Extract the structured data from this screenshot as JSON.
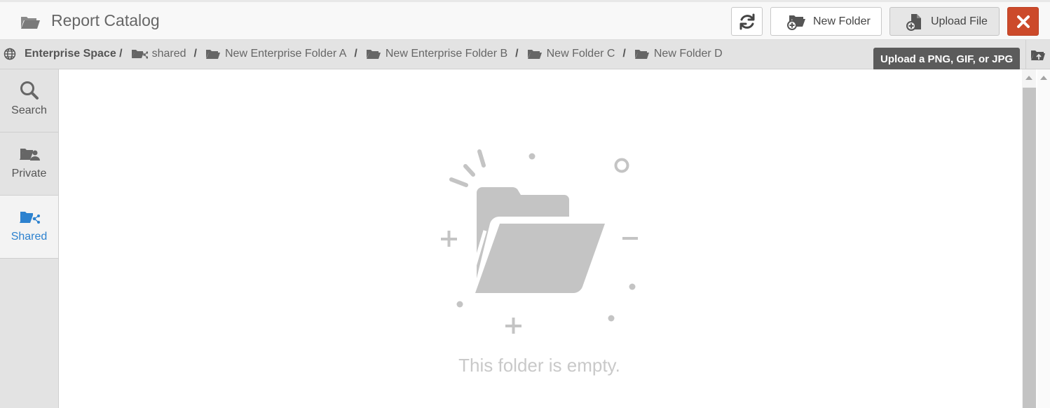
{
  "header": {
    "title": "Report Catalog",
    "buttons": {
      "new_folder": "New Folder",
      "upload_file": "Upload File"
    },
    "icons": {
      "title": "folder-open-icon",
      "refresh": "refresh-icon",
      "new_folder": "folder-plus-icon",
      "upload_file": "file-plus-icon",
      "close": "close-icon"
    },
    "close_color": "#cc4a2a"
  },
  "breadcrumb": {
    "root": "Enterprise Space /",
    "items": [
      "shared",
      "New Enterprise Folder A",
      "New Enterprise Folder B",
      "New Folder C",
      "New Folder D"
    ],
    "separator": "/",
    "root_icon": "globe-icon",
    "shared_icon": "shared-folder-icon",
    "folder_icon": "folder-open-icon",
    "up_icon": "folder-up-icon"
  },
  "tooltip": {
    "text": "Upload a PNG, GIF, or JPG"
  },
  "sidebar": {
    "items": [
      {
        "label": "Search",
        "icon": "search-icon",
        "active": false
      },
      {
        "label": "Private",
        "icon": "private-folder-icon",
        "active": false
      },
      {
        "label": "Shared",
        "icon": "shared-folder-icon",
        "active": true
      }
    ],
    "active_color": "#2d82cf"
  },
  "main": {
    "empty_message": "This folder is empty.",
    "empty_icon": "empty-folder-illustration"
  }
}
